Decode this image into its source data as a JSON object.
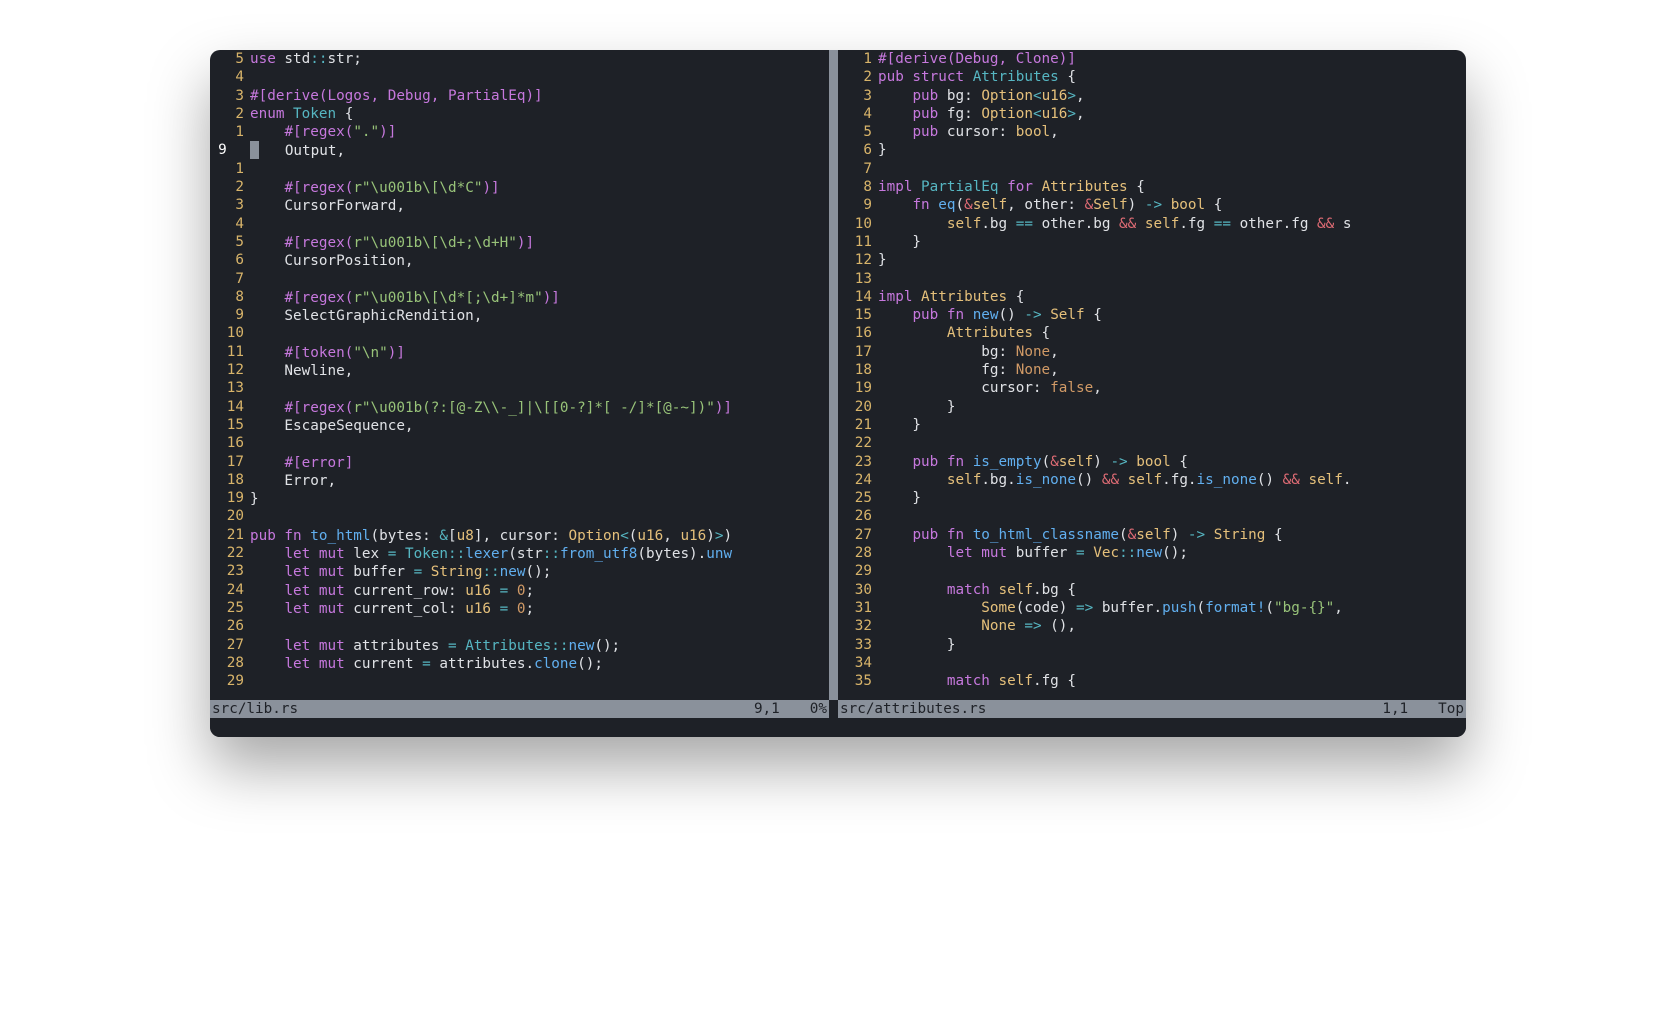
{
  "left": {
    "file": "src/lib.rs",
    "pos": "9,1",
    "pct": "0%",
    "gutter": [
      "5",
      "4",
      "3",
      "2",
      "1",
      "9  ",
      "1",
      "2",
      "3",
      "4",
      "5",
      "6",
      "7",
      "8",
      "9",
      "10",
      "11",
      "12",
      "13",
      "14",
      "15",
      "16",
      "17",
      "18",
      "19",
      "20",
      "21",
      "22",
      "23",
      "24",
      "25",
      "26",
      "27",
      "28",
      "29"
    ],
    "gutter_abs_index": 5,
    "lines": [
      [
        {
          "c": "c-kw",
          "t": "use"
        },
        {
          "t": " std"
        },
        {
          "c": "c-op",
          "t": "::"
        },
        {
          "t": "str;"
        }
      ],
      [],
      [
        {
          "c": "c-kw",
          "t": "#[derive(Logos, Debug, PartialEq)]"
        }
      ],
      [
        {
          "c": "c-kw",
          "t": "enum"
        },
        {
          "t": " "
        },
        {
          "c": "c-st",
          "t": "Token"
        },
        {
          "t": " {"
        }
      ],
      [
        {
          "t": "    "
        },
        {
          "c": "c-kw",
          "t": "#[regex("
        },
        {
          "c": "c-str",
          "t": "\".\""
        },
        {
          "c": "c-kw",
          "t": ")]"
        }
      ],
      [
        {
          "cursor": true
        },
        {
          "t": "   Output,"
        }
      ],
      [],
      [
        {
          "t": "    "
        },
        {
          "c": "c-kw",
          "t": "#[regex("
        },
        {
          "c": "c-str",
          "t": "r\"\\u001b\\[\\d*C\""
        },
        {
          "c": "c-kw",
          "t": ")]"
        }
      ],
      [
        {
          "t": "    CursorForward,"
        }
      ],
      [],
      [
        {
          "t": "    "
        },
        {
          "c": "c-kw",
          "t": "#[regex("
        },
        {
          "c": "c-str",
          "t": "r\"\\u001b\\[\\d+;\\d+H\""
        },
        {
          "c": "c-kw",
          "t": ")]"
        }
      ],
      [
        {
          "t": "    CursorPosition,"
        }
      ],
      [],
      [
        {
          "t": "    "
        },
        {
          "c": "c-kw",
          "t": "#[regex("
        },
        {
          "c": "c-str",
          "t": "r\"\\u001b\\[\\d*[;\\d+]*m\""
        },
        {
          "c": "c-kw",
          "t": ")]"
        }
      ],
      [
        {
          "t": "    SelectGraphicRendition,"
        }
      ],
      [],
      [
        {
          "t": "    "
        },
        {
          "c": "c-kw",
          "t": "#[token("
        },
        {
          "c": "c-str",
          "t": "\"\\n\""
        },
        {
          "c": "c-kw",
          "t": ")]"
        }
      ],
      [
        {
          "t": "    Newline,"
        }
      ],
      [],
      [
        {
          "t": "    "
        },
        {
          "c": "c-kw",
          "t": "#[regex("
        },
        {
          "c": "c-str",
          "t": "r\"\\u001b(?:[@-Z\\\\-_]|\\[[0-?]*[ -/]*[@-~])\""
        },
        {
          "c": "c-kw",
          "t": ")]"
        }
      ],
      [
        {
          "t": "    EscapeSequence,"
        }
      ],
      [],
      [
        {
          "t": "    "
        },
        {
          "c": "c-kw",
          "t": "#[error]"
        }
      ],
      [
        {
          "t": "    Error,"
        }
      ],
      [
        {
          "t": "}"
        }
      ],
      [],
      [
        {
          "c": "c-kw",
          "t": "pub fn"
        },
        {
          "t": " "
        },
        {
          "c": "c-fn",
          "t": "to_html"
        },
        {
          "t": "(bytes: "
        },
        {
          "c": "c-op",
          "t": "&"
        },
        {
          "t": "["
        },
        {
          "c": "c-ty",
          "t": "u8"
        },
        {
          "t": "], cursor: "
        },
        {
          "c": "c-ty",
          "t": "Option"
        },
        {
          "c": "c-op",
          "t": "<"
        },
        {
          "t": "("
        },
        {
          "c": "c-ty",
          "t": "u16"
        },
        {
          "t": ", "
        },
        {
          "c": "c-ty",
          "t": "u16"
        },
        {
          "t": ")"
        },
        {
          "c": "c-op",
          "t": ">"
        },
        {
          "t": ")"
        }
      ],
      [
        {
          "t": "    "
        },
        {
          "c": "c-kw",
          "t": "let mut"
        },
        {
          "t": " lex "
        },
        {
          "c": "c-op",
          "t": "="
        },
        {
          "t": " "
        },
        {
          "c": "c-st",
          "t": "Token"
        },
        {
          "c": "c-op",
          "t": "::"
        },
        {
          "c": "c-fn",
          "t": "lexer"
        },
        {
          "t": "(str"
        },
        {
          "c": "c-op",
          "t": "::"
        },
        {
          "c": "c-fn",
          "t": "from_utf8"
        },
        {
          "t": "(bytes)."
        },
        {
          "c": "c-fn",
          "t": "unw"
        }
      ],
      [
        {
          "t": "    "
        },
        {
          "c": "c-kw",
          "t": "let mut"
        },
        {
          "t": " buffer "
        },
        {
          "c": "c-op",
          "t": "="
        },
        {
          "t": " "
        },
        {
          "c": "c-ty",
          "t": "String"
        },
        {
          "c": "c-op",
          "t": "::"
        },
        {
          "c": "c-fn",
          "t": "new"
        },
        {
          "t": "();"
        }
      ],
      [
        {
          "t": "    "
        },
        {
          "c": "c-kw",
          "t": "let mut"
        },
        {
          "t": " current_row: "
        },
        {
          "c": "c-ty",
          "t": "u16"
        },
        {
          "t": " "
        },
        {
          "c": "c-op",
          "t": "="
        },
        {
          "t": " "
        },
        {
          "c": "c-num",
          "t": "0"
        },
        {
          "t": ";"
        }
      ],
      [
        {
          "t": "    "
        },
        {
          "c": "c-kw",
          "t": "let mut"
        },
        {
          "t": " current_col: "
        },
        {
          "c": "c-ty",
          "t": "u16"
        },
        {
          "t": " "
        },
        {
          "c": "c-op",
          "t": "="
        },
        {
          "t": " "
        },
        {
          "c": "c-num",
          "t": "0"
        },
        {
          "t": ";"
        }
      ],
      [],
      [
        {
          "t": "    "
        },
        {
          "c": "c-kw",
          "t": "let mut"
        },
        {
          "t": " attributes "
        },
        {
          "c": "c-op",
          "t": "="
        },
        {
          "t": " "
        },
        {
          "c": "c-st",
          "t": "Attributes"
        },
        {
          "c": "c-op",
          "t": "::"
        },
        {
          "c": "c-fn",
          "t": "new"
        },
        {
          "t": "();"
        }
      ],
      [
        {
          "t": "    "
        },
        {
          "c": "c-kw",
          "t": "let mut"
        },
        {
          "t": " current "
        },
        {
          "c": "c-op",
          "t": "="
        },
        {
          "t": " attributes."
        },
        {
          "c": "c-fn",
          "t": "clone"
        },
        {
          "t": "();"
        }
      ],
      []
    ]
  },
  "right": {
    "file": "src/attributes.rs",
    "pos": "1,1",
    "pct": "Top",
    "gutter": [
      "1",
      "2",
      "3",
      "4",
      "5",
      "6",
      "7",
      "8",
      "9",
      "10",
      "11",
      "12",
      "13",
      "14",
      "15",
      "16",
      "17",
      "18",
      "19",
      "20",
      "21",
      "22",
      "23",
      "24",
      "25",
      "26",
      "27",
      "28",
      "29",
      "30",
      "31",
      "32",
      "33",
      "34",
      "35"
    ],
    "lines": [
      [
        {
          "c": "c-kw",
          "t": "#[derive(Debug, Clone)]"
        }
      ],
      [
        {
          "c": "c-kw",
          "t": "pub struct"
        },
        {
          "t": " "
        },
        {
          "c": "c-st",
          "t": "Attributes"
        },
        {
          "t": " {"
        }
      ],
      [
        {
          "t": "    "
        },
        {
          "c": "c-kw",
          "t": "pub"
        },
        {
          "t": " bg: "
        },
        {
          "c": "c-ty",
          "t": "Option"
        },
        {
          "c": "c-op",
          "t": "<"
        },
        {
          "c": "c-ty",
          "t": "u16"
        },
        {
          "c": "c-op",
          "t": ">"
        },
        {
          "t": ","
        }
      ],
      [
        {
          "t": "    "
        },
        {
          "c": "c-kw",
          "t": "pub"
        },
        {
          "t": " fg: "
        },
        {
          "c": "c-ty",
          "t": "Option"
        },
        {
          "c": "c-op",
          "t": "<"
        },
        {
          "c": "c-ty",
          "t": "u16"
        },
        {
          "c": "c-op",
          "t": ">"
        },
        {
          "t": ","
        }
      ],
      [
        {
          "t": "    "
        },
        {
          "c": "c-kw",
          "t": "pub"
        },
        {
          "t": " cursor: "
        },
        {
          "c": "c-ty",
          "t": "bool"
        },
        {
          "t": ","
        }
      ],
      [
        {
          "t": "}"
        }
      ],
      [],
      [
        {
          "c": "c-kw",
          "t": "impl"
        },
        {
          "t": " "
        },
        {
          "c": "c-st",
          "t": "PartialEq"
        },
        {
          "t": " "
        },
        {
          "c": "c-kw",
          "t": "for"
        },
        {
          "t": " "
        },
        {
          "c": "c-ty",
          "t": "Attributes"
        },
        {
          "t": " {"
        }
      ],
      [
        {
          "t": "    "
        },
        {
          "c": "c-kw",
          "t": "fn"
        },
        {
          "t": " "
        },
        {
          "c": "c-fn",
          "t": "eq"
        },
        {
          "t": "("
        },
        {
          "c": "c-red",
          "t": "&"
        },
        {
          "c": "c-ty",
          "t": "self"
        },
        {
          "t": ", other: "
        },
        {
          "c": "c-red",
          "t": "&"
        },
        {
          "c": "c-ty",
          "t": "Self"
        },
        {
          "t": ") "
        },
        {
          "c": "c-op",
          "t": "->"
        },
        {
          "t": " "
        },
        {
          "c": "c-ty",
          "t": "bool"
        },
        {
          "t": " {"
        }
      ],
      [
        {
          "t": "        "
        },
        {
          "c": "c-ty",
          "t": "self"
        },
        {
          "t": ".bg "
        },
        {
          "c": "c-op",
          "t": "=="
        },
        {
          "t": " other.bg "
        },
        {
          "c": "c-red",
          "t": "&&"
        },
        {
          "t": " "
        },
        {
          "c": "c-ty",
          "t": "self"
        },
        {
          "t": ".fg "
        },
        {
          "c": "c-op",
          "t": "=="
        },
        {
          "t": " other.fg "
        },
        {
          "c": "c-red",
          "t": "&&"
        },
        {
          "t": " s"
        }
      ],
      [
        {
          "t": "    }"
        }
      ],
      [
        {
          "t": "}"
        }
      ],
      [],
      [
        {
          "c": "c-kw",
          "t": "impl"
        },
        {
          "t": " "
        },
        {
          "c": "c-ty",
          "t": "Attributes"
        },
        {
          "t": " {"
        }
      ],
      [
        {
          "t": "    "
        },
        {
          "c": "c-kw",
          "t": "pub fn"
        },
        {
          "t": " "
        },
        {
          "c": "c-fn",
          "t": "new"
        },
        {
          "t": "() "
        },
        {
          "c": "c-op",
          "t": "->"
        },
        {
          "t": " "
        },
        {
          "c": "c-ty",
          "t": "Self"
        },
        {
          "t": " {"
        }
      ],
      [
        {
          "t": "        "
        },
        {
          "c": "c-ty",
          "t": "Attributes"
        },
        {
          "t": " {"
        }
      ],
      [
        {
          "t": "            bg: "
        },
        {
          "c": "c-num",
          "t": "None"
        },
        {
          "t": ","
        }
      ],
      [
        {
          "t": "            fg: "
        },
        {
          "c": "c-num",
          "t": "None"
        },
        {
          "t": ","
        }
      ],
      [
        {
          "t": "            cursor: "
        },
        {
          "c": "c-num",
          "t": "false"
        },
        {
          "t": ","
        }
      ],
      [
        {
          "t": "        }"
        }
      ],
      [
        {
          "t": "    }"
        }
      ],
      [],
      [
        {
          "t": "    "
        },
        {
          "c": "c-kw",
          "t": "pub fn"
        },
        {
          "t": " "
        },
        {
          "c": "c-fn",
          "t": "is_empty"
        },
        {
          "t": "("
        },
        {
          "c": "c-red",
          "t": "&"
        },
        {
          "c": "c-ty",
          "t": "self"
        },
        {
          "t": ") "
        },
        {
          "c": "c-op",
          "t": "->"
        },
        {
          "t": " "
        },
        {
          "c": "c-ty",
          "t": "bool"
        },
        {
          "t": " {"
        }
      ],
      [
        {
          "t": "        "
        },
        {
          "c": "c-ty",
          "t": "self"
        },
        {
          "t": ".bg."
        },
        {
          "c": "c-fn",
          "t": "is_none"
        },
        {
          "t": "() "
        },
        {
          "c": "c-red",
          "t": "&&"
        },
        {
          "t": " "
        },
        {
          "c": "c-ty",
          "t": "self"
        },
        {
          "t": ".fg."
        },
        {
          "c": "c-fn",
          "t": "is_none"
        },
        {
          "t": "() "
        },
        {
          "c": "c-red",
          "t": "&&"
        },
        {
          "t": " "
        },
        {
          "c": "c-ty",
          "t": "self"
        },
        {
          "t": "."
        }
      ],
      [
        {
          "t": "    }"
        }
      ],
      [],
      [
        {
          "t": "    "
        },
        {
          "c": "c-kw",
          "t": "pub fn"
        },
        {
          "t": " "
        },
        {
          "c": "c-fn",
          "t": "to_html_classname"
        },
        {
          "t": "("
        },
        {
          "c": "c-red",
          "t": "&"
        },
        {
          "c": "c-ty",
          "t": "self"
        },
        {
          "t": ") "
        },
        {
          "c": "c-op",
          "t": "->"
        },
        {
          "t": " "
        },
        {
          "c": "c-ty",
          "t": "String"
        },
        {
          "t": " {"
        }
      ],
      [
        {
          "t": "        "
        },
        {
          "c": "c-kw",
          "t": "let mut"
        },
        {
          "t": " buffer "
        },
        {
          "c": "c-op",
          "t": "="
        },
        {
          "t": " "
        },
        {
          "c": "c-ty",
          "t": "Vec"
        },
        {
          "c": "c-op",
          "t": "::"
        },
        {
          "c": "c-fn",
          "t": "new"
        },
        {
          "t": "();"
        }
      ],
      [],
      [
        {
          "t": "        "
        },
        {
          "c": "c-kw",
          "t": "match"
        },
        {
          "t": " "
        },
        {
          "c": "c-ty",
          "t": "self"
        },
        {
          "t": ".bg {"
        }
      ],
      [
        {
          "t": "            "
        },
        {
          "c": "c-ty",
          "t": "Some"
        },
        {
          "t": "(code) "
        },
        {
          "c": "c-op",
          "t": "=>"
        },
        {
          "t": " buffer."
        },
        {
          "c": "c-fn",
          "t": "push"
        },
        {
          "t": "("
        },
        {
          "c": "c-fn",
          "t": "format!"
        },
        {
          "t": "("
        },
        {
          "c": "c-str",
          "t": "\"bg-{}\""
        },
        {
          "t": ","
        }
      ],
      [
        {
          "t": "            "
        },
        {
          "c": "c-ty",
          "t": "None"
        },
        {
          "t": " "
        },
        {
          "c": "c-op",
          "t": "=>"
        },
        {
          "t": " (),"
        }
      ],
      [
        {
          "t": "        }"
        }
      ],
      [],
      [
        {
          "t": "        "
        },
        {
          "c": "c-kw",
          "t": "match"
        },
        {
          "t": " "
        },
        {
          "c": "c-ty",
          "t": "self"
        },
        {
          "t": ".fg {"
        }
      ]
    ]
  }
}
